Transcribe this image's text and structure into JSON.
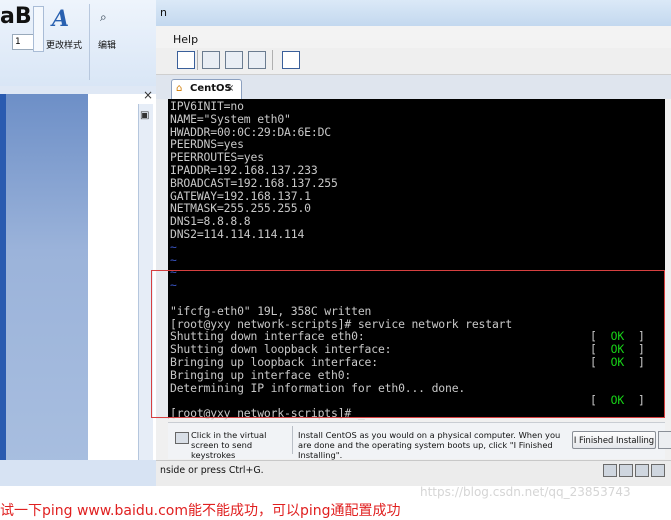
{
  "word": {
    "ribbon": {
      "big_text": "aB",
      "number_value": "1",
      "style_label": "更改样式",
      "edit_label": "编辑"
    },
    "close_glyph": "×"
  },
  "vm": {
    "title_fragment": "n",
    "menu": {
      "help": "Help"
    },
    "tab": {
      "label": "CentOS"
    },
    "console": {
      "config_lines": [
        "IPV6INIT=no",
        "NAME=\"System eth0\"",
        "HWADDR=00:0C:29:DA:6E:DC",
        "PEERDNS=yes",
        "PEERROUTES=yes",
        "IPADDR=192.168.137.233",
        "BROADCAST=192.168.137.255",
        "GATEWAY=192.168.137.1",
        "NETMASK=255.255.255.0",
        "DNS1=8.8.8.8",
        "DNS2=114.114.114.114"
      ],
      "tilde": "~",
      "write_msg": "\"ifcfg-eth0\" 19L, 358C written",
      "prompt_cmd": "[root@yxy network-scripts]# service network restart",
      "service_lines": [
        "Shutting down interface eth0:",
        "Shutting down loopback interface:",
        "Bringing up loopback interface:",
        "Bringing up interface eth0:",
        "Determining IP information for eth0... done."
      ],
      "ok_open": "[",
      "ok_text": "OK",
      "ok_close": "]",
      "final_prompt": "[root@yxy network-scripts]# _"
    },
    "infobar": {
      "hint1": "Click in the virtual screen to send keystrokes",
      "hint2": "Install CentOS as you would on a physical computer. When you are done and the operating system boots up, click \"I Finished Installing\".",
      "finish_button": "I Finished Installing"
    },
    "status": {
      "text": "nside or press Ctrl+G."
    }
  },
  "caption": {
    "text": "试一下ping www.baidu.com能不能成功，可以ping通配置成功",
    "watermark": "https://blog.csdn.net/qq_23853743"
  },
  "colors": {
    "terminal_ok": "#17d317",
    "annotation_red": "#d64040",
    "terminal_bg": "#000000"
  }
}
